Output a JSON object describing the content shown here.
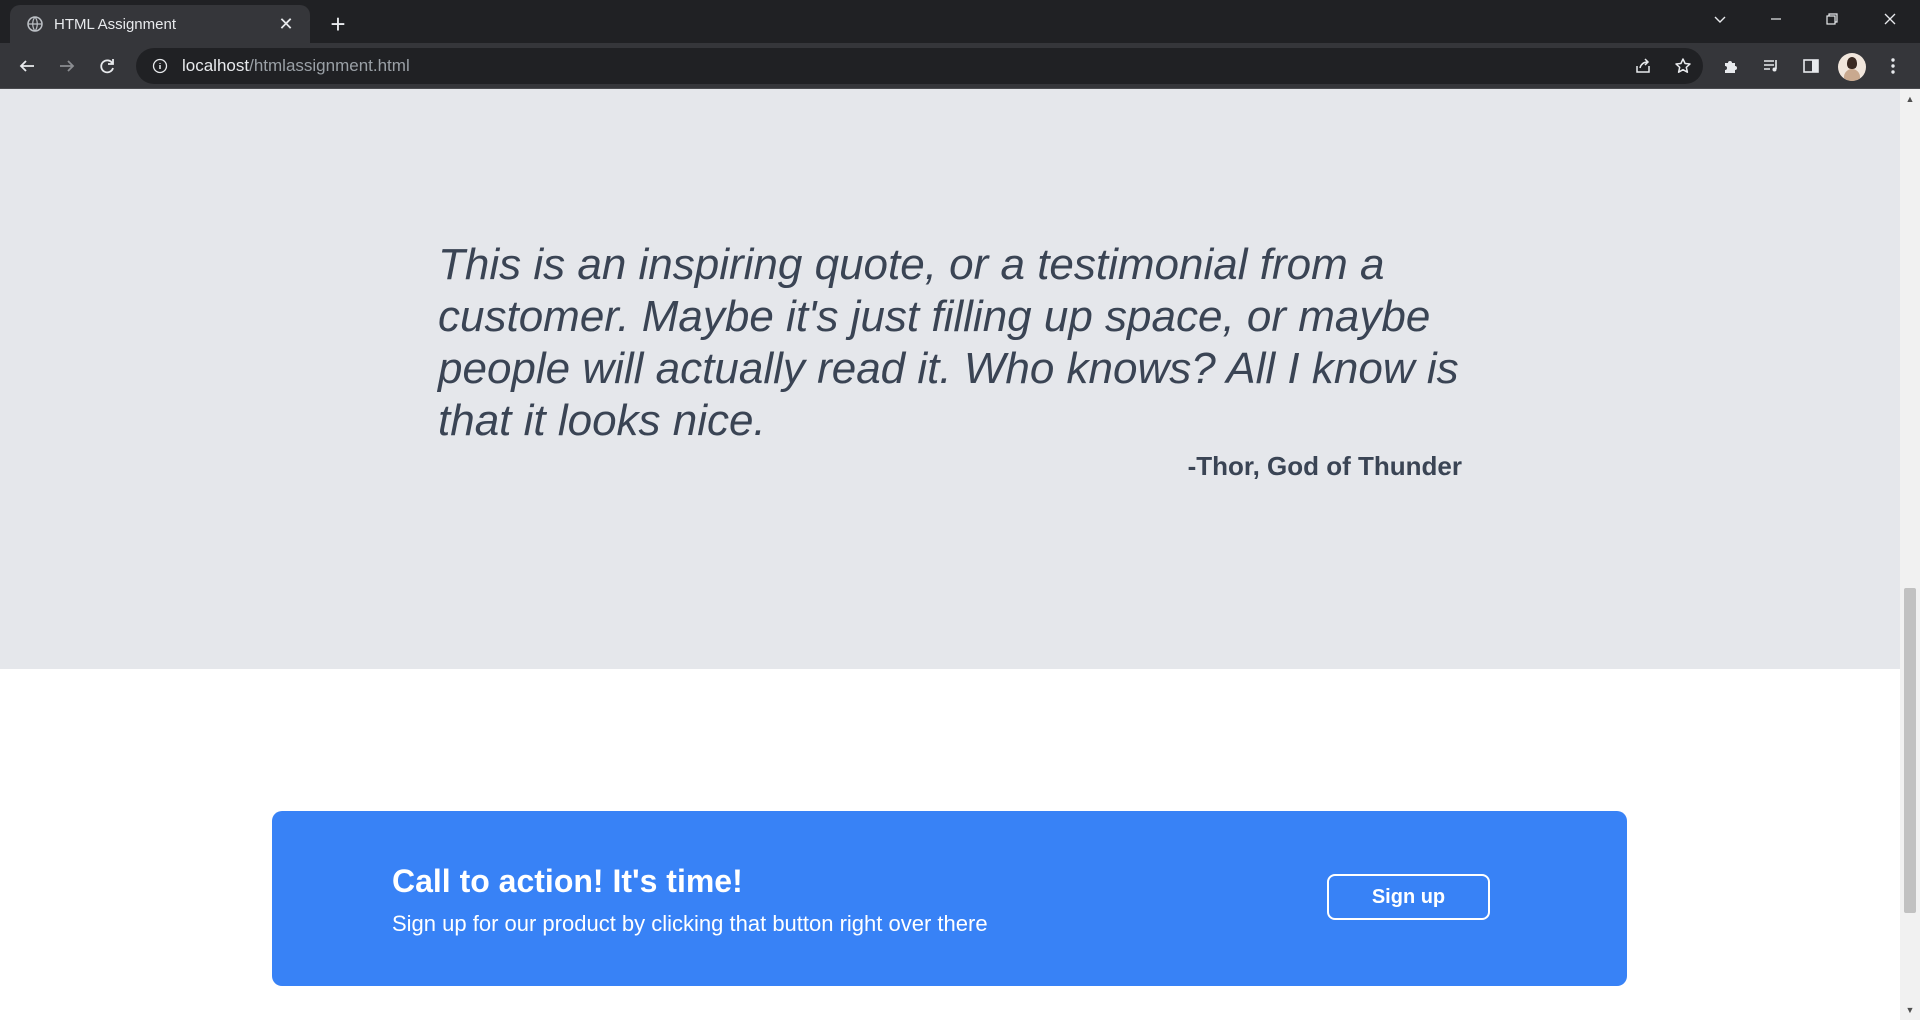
{
  "browser": {
    "tab_title": "HTML Assignment",
    "tab_close": "✕",
    "new_tab": "+",
    "url_host": "localhost",
    "url_path": "/htmlassignment.html"
  },
  "page": {
    "quote": "This is an inspiring quote, or a testimonial from a customer. Maybe it's just filling up space, or maybe people will actually read it. Who knows? All I know is that it looks nice.",
    "quote_author": "-Thor, God of Thunder",
    "cta": {
      "title": "Call to action! It's time!",
      "subtitle": "Sign up for our product by clicking that button right over there",
      "button_label": "Sign up"
    }
  },
  "colors": {
    "quote_background": "#e5e7eb",
    "quote_text": "#3a4454",
    "cta_background": "#3882f6",
    "chrome_dark": "#202124",
    "chrome_toolbar": "#35363a"
  },
  "icons": {
    "favicon": "globe-icon",
    "back": "back-arrow-icon",
    "forward": "forward-arrow-icon",
    "reload": "reload-icon",
    "site_info": "info-icon",
    "share": "share-icon",
    "bookmark": "star-icon",
    "extensions": "puzzle-icon",
    "media": "media-queue-icon",
    "side_panel": "side-panel-icon",
    "menu": "kebab-menu-icon"
  }
}
